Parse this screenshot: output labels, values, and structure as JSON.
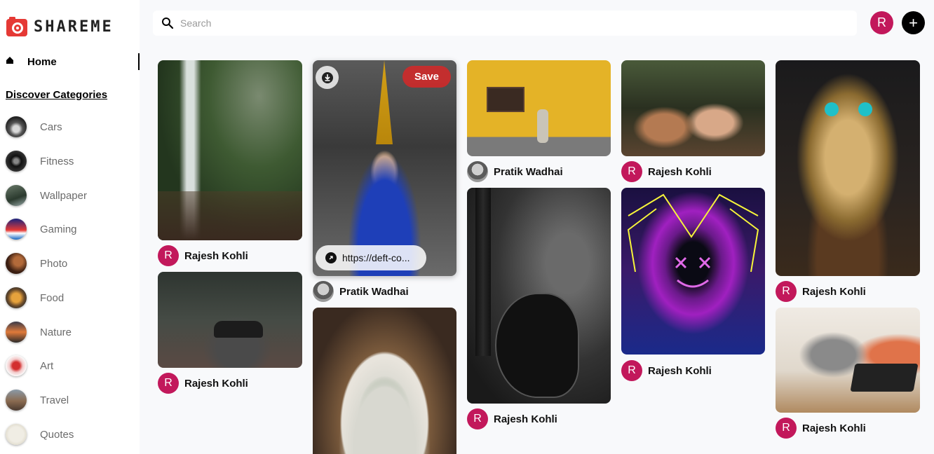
{
  "app": {
    "brand": "SHAREME"
  },
  "sidebar": {
    "home_label": "Home",
    "discover_label": "Discover Categories",
    "categories": [
      {
        "label": "Cars"
      },
      {
        "label": "Fitness"
      },
      {
        "label": "Wallpaper"
      },
      {
        "label": "Gaming"
      },
      {
        "label": "Photo"
      },
      {
        "label": "Food"
      },
      {
        "label": "Nature"
      },
      {
        "label": "Art"
      },
      {
        "label": "Travel"
      },
      {
        "label": "Quotes"
      }
    ]
  },
  "header": {
    "search_placeholder": "Search",
    "user_initial": "R",
    "add_symbol": "+"
  },
  "pins": [
    {
      "author": "Rajesh Kohli",
      "initial": "R"
    },
    {
      "author": "Rajesh Kohli",
      "initial": "R"
    },
    {
      "author": "Pratik Wadhai",
      "save_label": "Save",
      "link_text": "https://deft-co..."
    },
    {
      "author": "Pratik Wadhai"
    },
    {
      "author": "Rajesh Kohli",
      "initial": "R"
    },
    {
      "author": "Rajesh Kohli",
      "initial": "R"
    },
    {
      "author": "Rajesh Kohli",
      "initial": "R"
    },
    {
      "author": "Rajesh Kohli",
      "initial": "R"
    },
    {
      "author": "Rajesh Kohli",
      "initial": "R"
    }
  ],
  "colors": {
    "accent": "#c2185b",
    "save": "#dc2626",
    "background": "#f8f9fb"
  }
}
